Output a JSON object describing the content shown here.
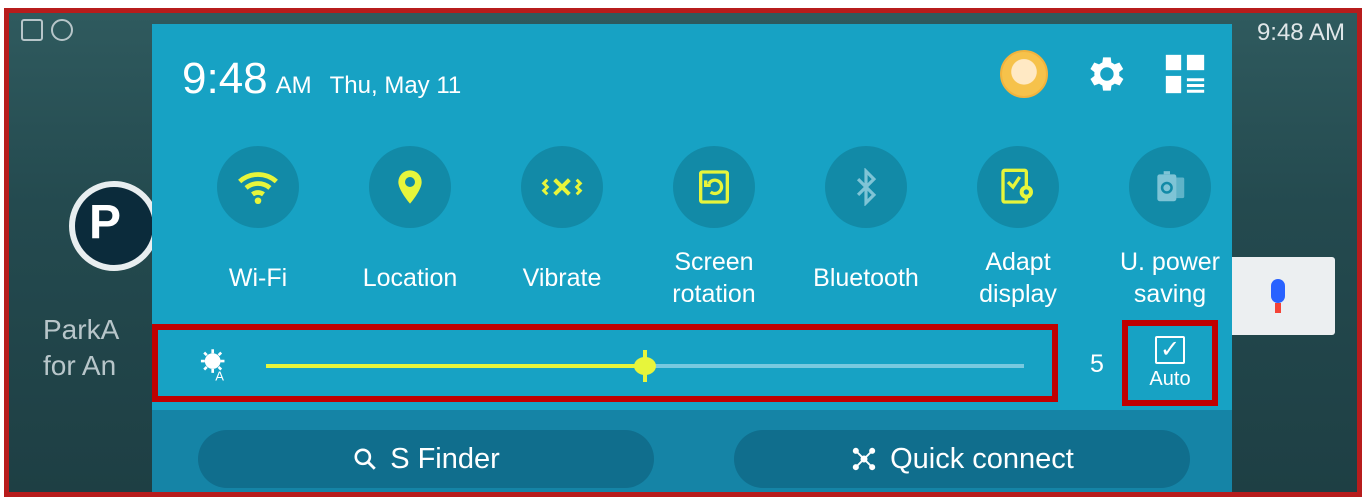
{
  "home": {
    "clock": "9:48 AM",
    "app_label_line1": "ParkA",
    "app_label_line2": "for An",
    "app_icon_letter": "P"
  },
  "panel": {
    "time": "9:48",
    "ampm": "AM",
    "date": "Thu, May 11",
    "toggles": [
      {
        "label": "Wi-Fi",
        "icon": "wifi-icon"
      },
      {
        "label": "Location",
        "icon": "location-icon"
      },
      {
        "label": "Vibrate",
        "icon": "vibrate-icon"
      },
      {
        "label": "Screen\nrotation",
        "icon": "screen-rotation-icon"
      },
      {
        "label": "Bluetooth",
        "icon": "bluetooth-icon"
      },
      {
        "label": "Adapt\ndisplay",
        "icon": "adapt-display-icon"
      },
      {
        "label": "U. power\nsaving",
        "icon": "ultra-power-saving-icon"
      }
    ],
    "brightness": {
      "level": "5",
      "auto_label": "Auto",
      "auto_checked": true,
      "fraction": 0.5
    },
    "buttons": {
      "s_finder": "S Finder",
      "quick_connect": "Quick connect"
    }
  },
  "colors": {
    "panel": "#17a2c4",
    "accent": "#e7f53b",
    "highlight": "#c00000"
  }
}
